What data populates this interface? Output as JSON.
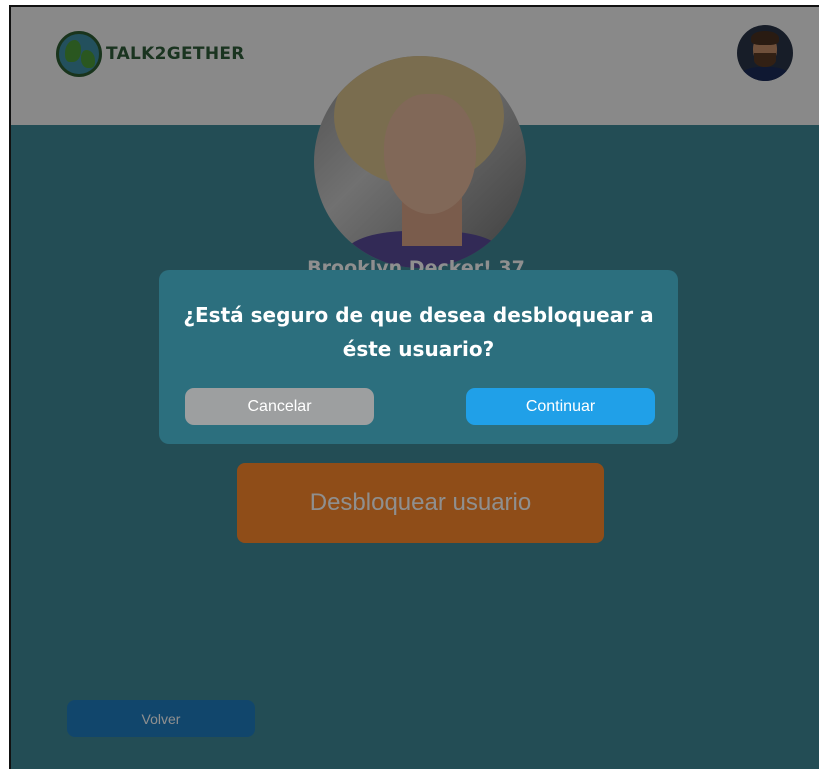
{
  "header": {
    "brand": "TALK2GETHER"
  },
  "profile": {
    "name_line": "Brooklyn Decker! 37"
  },
  "actions": {
    "unblock_label": "Desbloquear usuario",
    "back_label": "Volver"
  },
  "modal": {
    "title_line1": "¿Está seguro de que desea desbloquear a",
    "title_line2": "éste usuario?",
    "cancel_label": "Cancelar",
    "continue_label": "Continuar"
  },
  "colors": {
    "page_background": "#3f8a98",
    "header_background": "#f4f4f4",
    "unblock_button": "#ff8a2b",
    "back_button": "#1f7ec0",
    "modal_background": "#2c6f7e",
    "cancel_button": "#9d9fa0",
    "continue_button": "#20a0e8"
  },
  "icons": {
    "logo": "globe-icon",
    "user_avatar": "avatar-photo",
    "profile_photo": "profile-photo"
  }
}
